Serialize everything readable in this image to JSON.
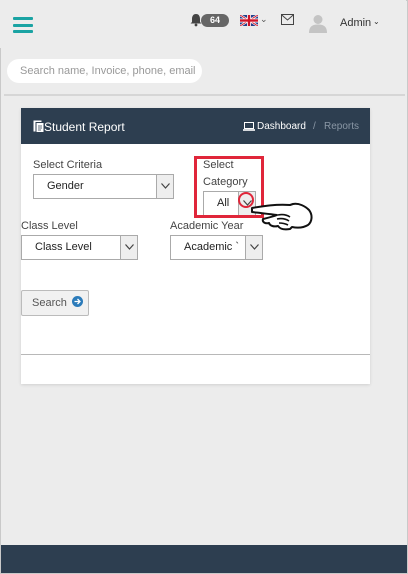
{
  "header": {
    "notification_count": "64",
    "language_flag": "uk-flag",
    "user_name": "Admin"
  },
  "search": {
    "placeholder": "Search name, Invoice, phone, email"
  },
  "card": {
    "title": "Student Report",
    "breadcrumb": {
      "home": "Dashboard",
      "separator": "/",
      "current": "Reports"
    }
  },
  "form": {
    "select_criteria": {
      "label": "Select Criteria",
      "value": "Gender"
    },
    "select_category": {
      "label_line1": "Select",
      "label_line2": "Category",
      "value": "All"
    },
    "class_level": {
      "label": "Class Level",
      "value": "Class Level"
    },
    "academic_year": {
      "label": "Academic Year",
      "value": "Academic `"
    },
    "search_button": "Search"
  },
  "colors": {
    "accent": "#1aa3a3",
    "card_header": "#2d3e50",
    "highlight": "#e0263a"
  }
}
